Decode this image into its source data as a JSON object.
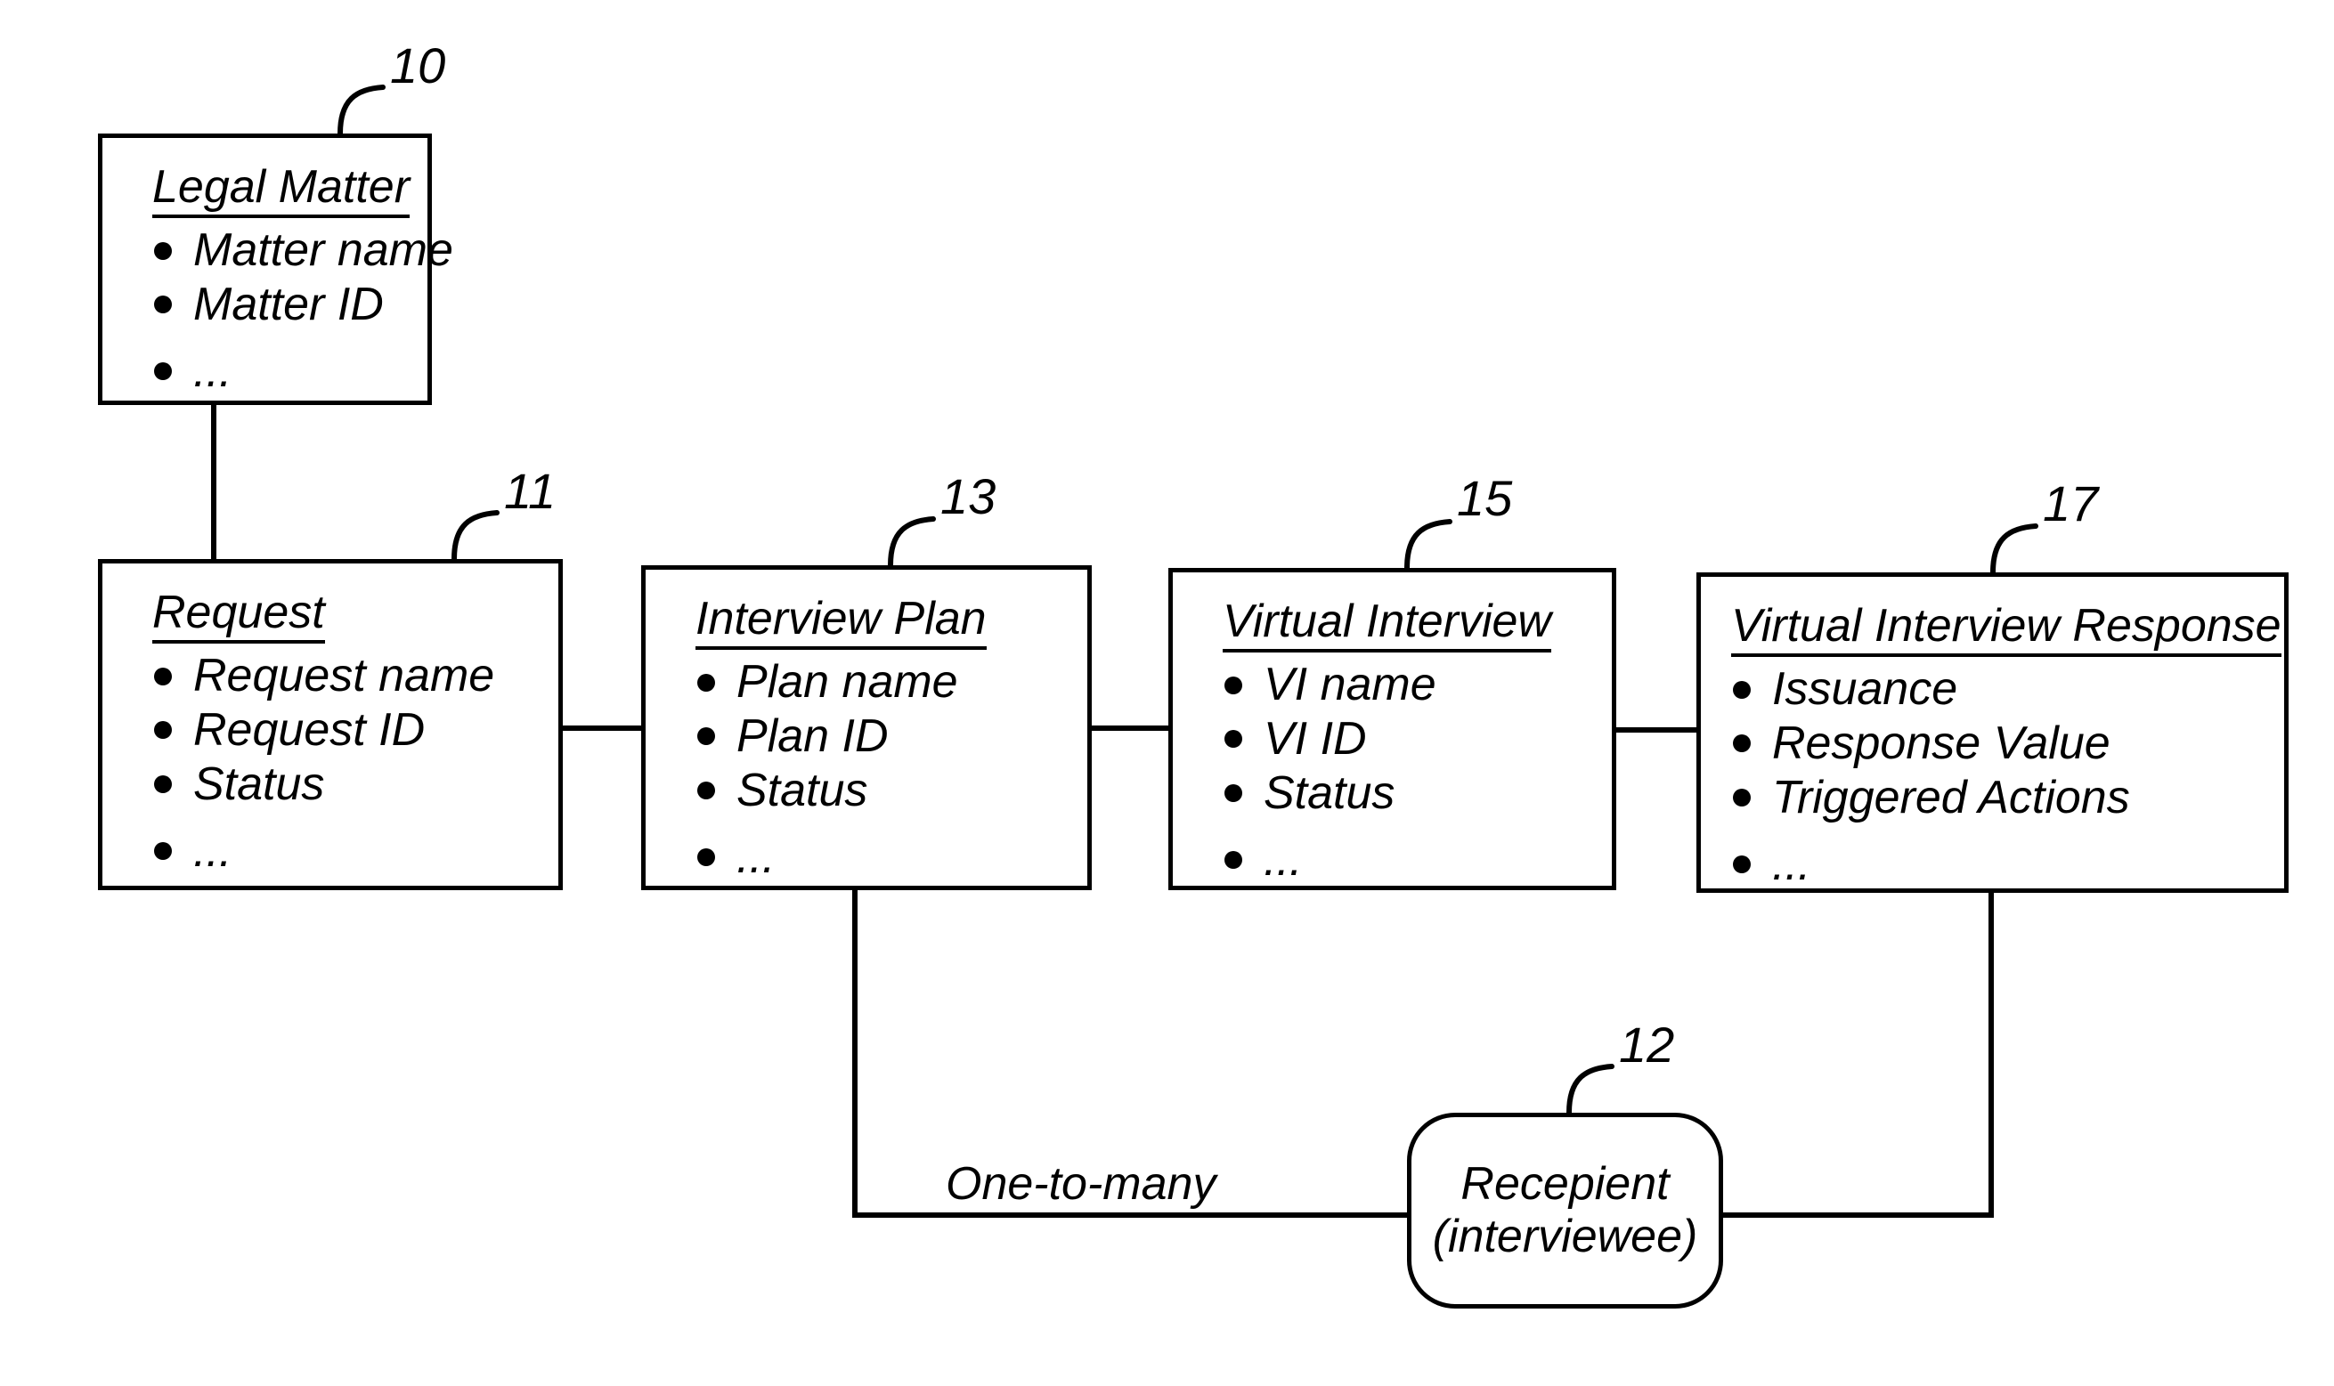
{
  "figure": {
    "kind": "entity-relationship-diagram",
    "background_color": "#ffffff",
    "line_color": "#000000"
  },
  "entities": [
    {
      "ref": "10",
      "title": "Legal Matter",
      "attributes": [
        "Matter name",
        "Matter ID",
        "..."
      ]
    },
    {
      "ref": "11",
      "title": "Request",
      "attributes": [
        "Request name",
        "Request ID",
        "Status",
        "..."
      ]
    },
    {
      "ref": "13",
      "title": "Interview Plan",
      "attributes": [
        "Plan name",
        "Plan ID",
        "Status",
        "..."
      ]
    },
    {
      "ref": "15",
      "title": "Virtual Interview",
      "attributes": [
        "VI name",
        "VI ID",
        "Status",
        "..."
      ]
    },
    {
      "ref": "17",
      "title": "Virtual Interview Response",
      "attributes": [
        "Issuance",
        "Response Value",
        "Triggered Actions",
        "..."
      ]
    }
  ],
  "recipient": {
    "ref": "12",
    "line1": "Recepient",
    "line2": "(interviewee)"
  },
  "relationships": {
    "one_to_many_label": "One-to-many"
  }
}
